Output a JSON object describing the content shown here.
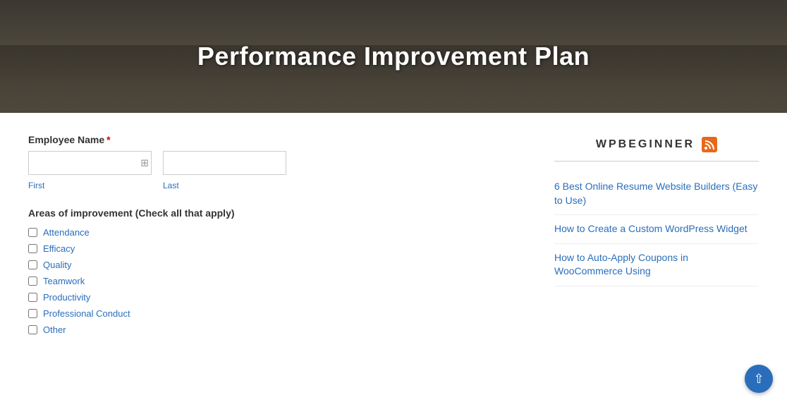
{
  "hero": {
    "title": "Performance Improvement Plan"
  },
  "form": {
    "employee_name_label": "Employee Name",
    "required_marker": "*",
    "first_label": "First",
    "last_label": "Last",
    "first_placeholder": "",
    "last_placeholder": "",
    "areas_label": "Areas of improvement (Check all that apply)",
    "checkboxes": [
      {
        "id": "attendance",
        "label": "Attendance"
      },
      {
        "id": "efficacy",
        "label": "Efficacy"
      },
      {
        "id": "quality",
        "label": "Quality"
      },
      {
        "id": "teamwork",
        "label": "Teamwork"
      },
      {
        "id": "productivity",
        "label": "Productivity"
      },
      {
        "id": "professional-conduct",
        "label": "Professional Conduct"
      },
      {
        "id": "other",
        "label": "Other"
      }
    ]
  },
  "sidebar": {
    "title": "WPBEGINNER",
    "links": [
      {
        "text": "6 Best Online Resume Website Builders (Easy to Use)"
      },
      {
        "text": "How to Create a Custom WordPress Widget"
      },
      {
        "text": "How to Auto-Apply Coupons in WooCommerce Using"
      }
    ]
  },
  "scroll_top": {
    "aria_label": "Scroll to top"
  }
}
